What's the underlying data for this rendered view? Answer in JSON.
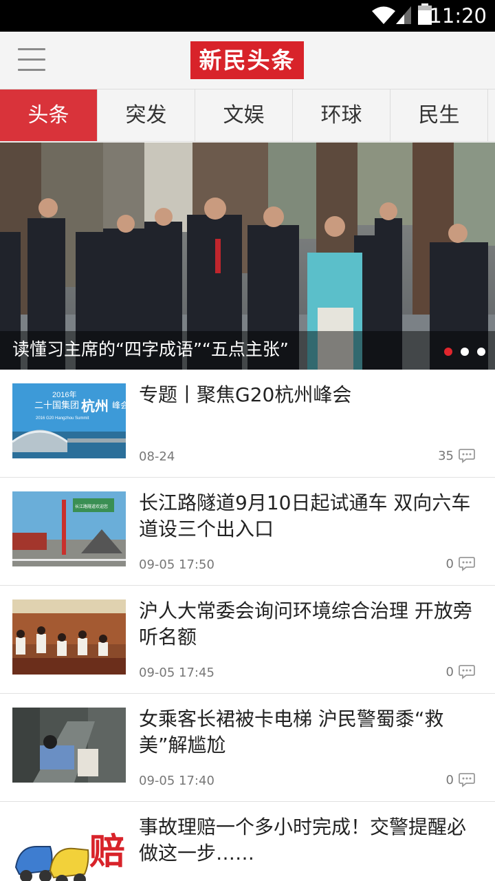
{
  "status_bar": {
    "time": "11:20"
  },
  "header": {
    "logo": "新民头条"
  },
  "tabs": [
    {
      "label": "头条",
      "active": true
    },
    {
      "label": "突发",
      "active": false
    },
    {
      "label": "文娱",
      "active": false
    },
    {
      "label": "环球",
      "active": false
    },
    {
      "label": "民生",
      "active": false
    }
  ],
  "banner": {
    "caption": "读懂习主席的“四字成语”“五点主张”",
    "slides": 3,
    "active_slide": 1
  },
  "thumbnails": {
    "item1": {
      "year": "2016年",
      "line1": "二十国集团",
      "city": "杭州",
      "word": "峰会",
      "line2": "2016 G20 Hangzhou Summit"
    },
    "item2": {
      "sign": "长江路隧道欢迎您"
    },
    "item5": {
      "char": "赔"
    }
  },
  "news": [
    {
      "title": "专题丨聚焦G20杭州峰会",
      "date": "08-24",
      "comments": "35"
    },
    {
      "title": "长江路隧道9月10日起试通车 双向六车道设三个出入口",
      "date": "09-05 17:50",
      "comments": "0"
    },
    {
      "title": "沪人大常委会询问环境综合治理 开放旁听名额",
      "date": "09-05 17:45",
      "comments": "0"
    },
    {
      "title": "女乘客长裙被卡电梯 沪民警蜀黍“救美”解尴尬",
      "date": "09-05 17:40",
      "comments": "0"
    },
    {
      "title": "事故理赔一个多小时完成！交警提醒必做这一步……",
      "date": "",
      "comments": ""
    }
  ],
  "colors": {
    "brand_red": "#d8232a",
    "tab_active": "#d9333a",
    "dot_active": "#e0262d"
  }
}
